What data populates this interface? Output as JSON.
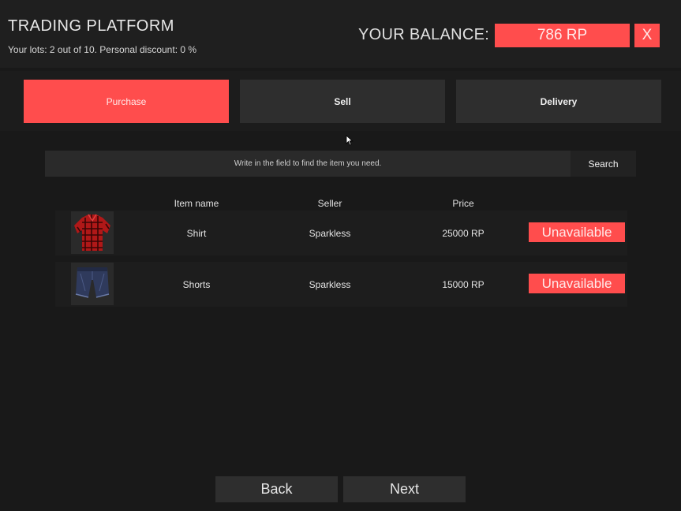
{
  "header": {
    "title": "TRADING PLATFORM",
    "subtitle": "Your lots: 2 out of 10. Personal discount: 0 %",
    "balance_label": "YOUR BALANCE:",
    "balance_value": "786 RP",
    "close_label": "X"
  },
  "tabs": [
    {
      "label": "Purchase",
      "active": true
    },
    {
      "label": "Sell",
      "active": false
    },
    {
      "label": "Delivery",
      "active": false
    }
  ],
  "search": {
    "placeholder": "Write in the field to find the item you need.",
    "button_label": "Search"
  },
  "table": {
    "columns": [
      "Item name",
      "Seller",
      "Price"
    ],
    "rows": [
      {
        "icon": "shirt-icon",
        "name": "Shirt",
        "seller": "Sparkless",
        "price": "25000 RP",
        "status": "Unavailable"
      },
      {
        "icon": "shorts-icon",
        "name": "Shorts",
        "seller": "Sparkless",
        "price": "15000 RP",
        "status": "Unavailable"
      }
    ]
  },
  "nav": {
    "back_label": "Back",
    "next_label": "Next"
  },
  "colors": {
    "accent": "#ff4d4d",
    "background": "#191919",
    "panel": "#2e2e2e"
  }
}
